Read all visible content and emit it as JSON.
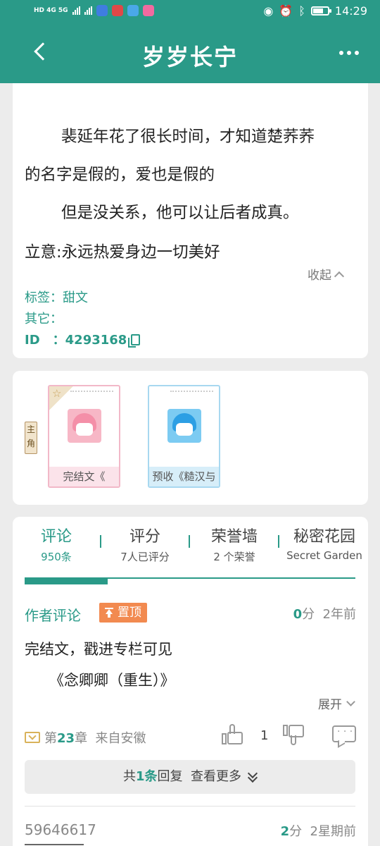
{
  "status": {
    "network": "HD 4G 5G",
    "time": "14:29",
    "battery_fill": 0.7
  },
  "header": {
    "title": "岁岁长宁"
  },
  "intro": {
    "line1": "裴延年花了很长时间，才知道楚荞荞",
    "line2": "的名字是假的，爱也是假的",
    "line3": "但是没关系，他可以让后者成真。",
    "line4": "立意:永远热爱身边一切美好",
    "collapse_label": "收起",
    "tags_label": "标签：",
    "tags_value": "甜文",
    "other_label": "其它：",
    "id_label": "ID　：",
    "id_value": "4293168"
  },
  "characters": {
    "role_tag": "主角",
    "items": [
      {
        "name": "完结文《",
        "star": "☆"
      },
      {
        "name": "预收《糙汉与"
      }
    ]
  },
  "tabs": [
    {
      "label": "评论",
      "sub": "950条"
    },
    {
      "label": "评分",
      "sub": "7人已评分"
    },
    {
      "label": "荣誉墙",
      "sub": "2 个荣誉"
    },
    {
      "label": "秘密花园",
      "sub": "Secret Garden"
    }
  ],
  "comment": {
    "author": "作者评论",
    "pin": "置顶",
    "score_num": "0",
    "score_unit": "分",
    "time": "2年前",
    "body1": "完结文，戳进专栏可见",
    "body2": "《念卿卿（重生）》",
    "expand": "展开",
    "chapter_prefix": "第",
    "chapter_num": "23",
    "chapter_suffix": "章",
    "from": "来自安徽",
    "likes": "1",
    "reply_prefix": "共",
    "reply_count": "1条",
    "reply_suffix": "回复",
    "reply_more": "查看更多"
  },
  "comment2": {
    "user": "59646617",
    "score_num": "2",
    "score_unit": "分",
    "time": "2星期前"
  }
}
